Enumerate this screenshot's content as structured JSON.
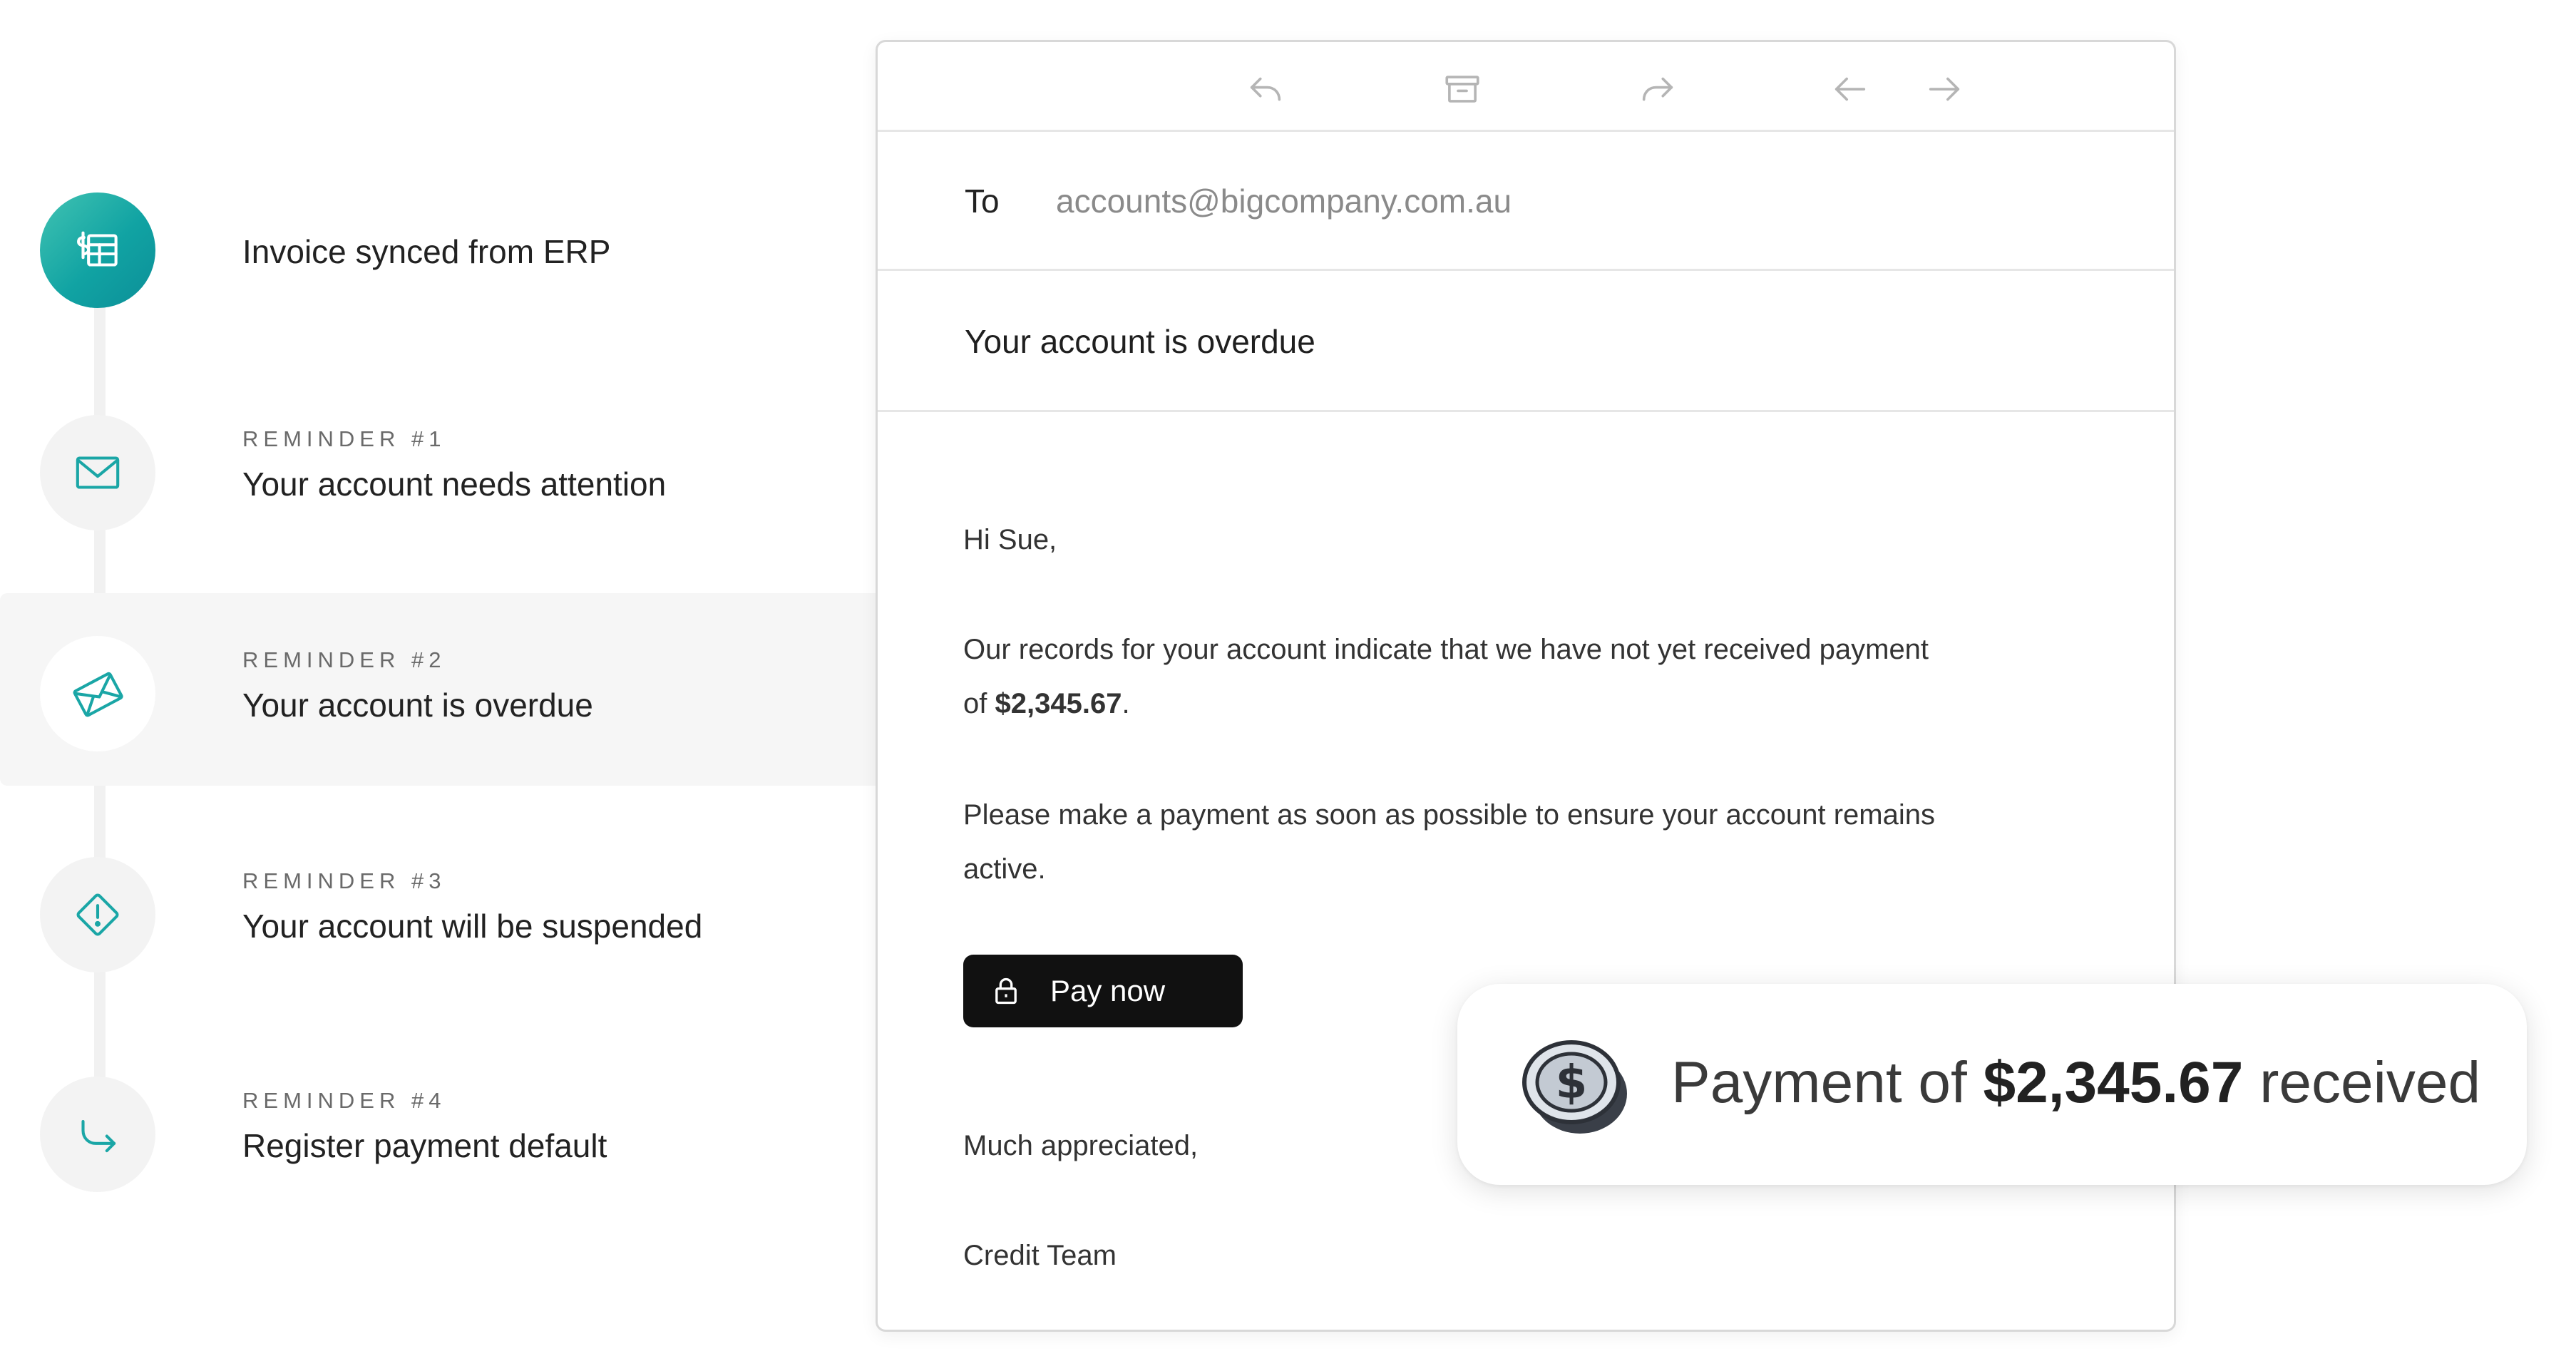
{
  "timeline": {
    "steps": [
      {
        "eyebrow": "",
        "title": "Invoice synced from ERP",
        "icon": "invoice-icon"
      },
      {
        "eyebrow": "REMINDER #1",
        "title": "Your account needs attention",
        "icon": "mail-icon"
      },
      {
        "eyebrow": "REMINDER #2",
        "title": "Your account is overdue",
        "icon": "open-mail-icon"
      },
      {
        "eyebrow": "REMINDER #3",
        "title": "Your account will be suspended",
        "icon": "warning-icon"
      },
      {
        "eyebrow": "REMINDER #4",
        "title": "Register payment default",
        "icon": "arrow-return-icon"
      }
    ],
    "active_step": 2,
    "accent_color": "#1aa6a6"
  },
  "email": {
    "toolbar": {
      "icons": [
        "reply-icon",
        "archive-icon",
        "forward-icon",
        "arrow-left-icon",
        "arrow-right-icon"
      ]
    },
    "to_label": "To",
    "to_value": "accounts@bigcompany.com.au",
    "subject": "Your account is overdue",
    "body": {
      "greeting": "Hi Sue,",
      "para1_line1": "Our records for your account indicate that we have not yet received payment",
      "para1_prefix": "of ",
      "para1_amount": "$2,345.67",
      "para1_suffix": ".",
      "para2_line1": "Please make a payment as soon as possible to ensure your account remains",
      "para2_line2": "active.",
      "closing": "Much appreciated,",
      "signature": "Credit Team"
    },
    "pay_button_label": "Pay now"
  },
  "toast": {
    "prefix": "Payment of ",
    "amount": "$2,345.67",
    "suffix": " received",
    "icon": "coin-icon"
  }
}
